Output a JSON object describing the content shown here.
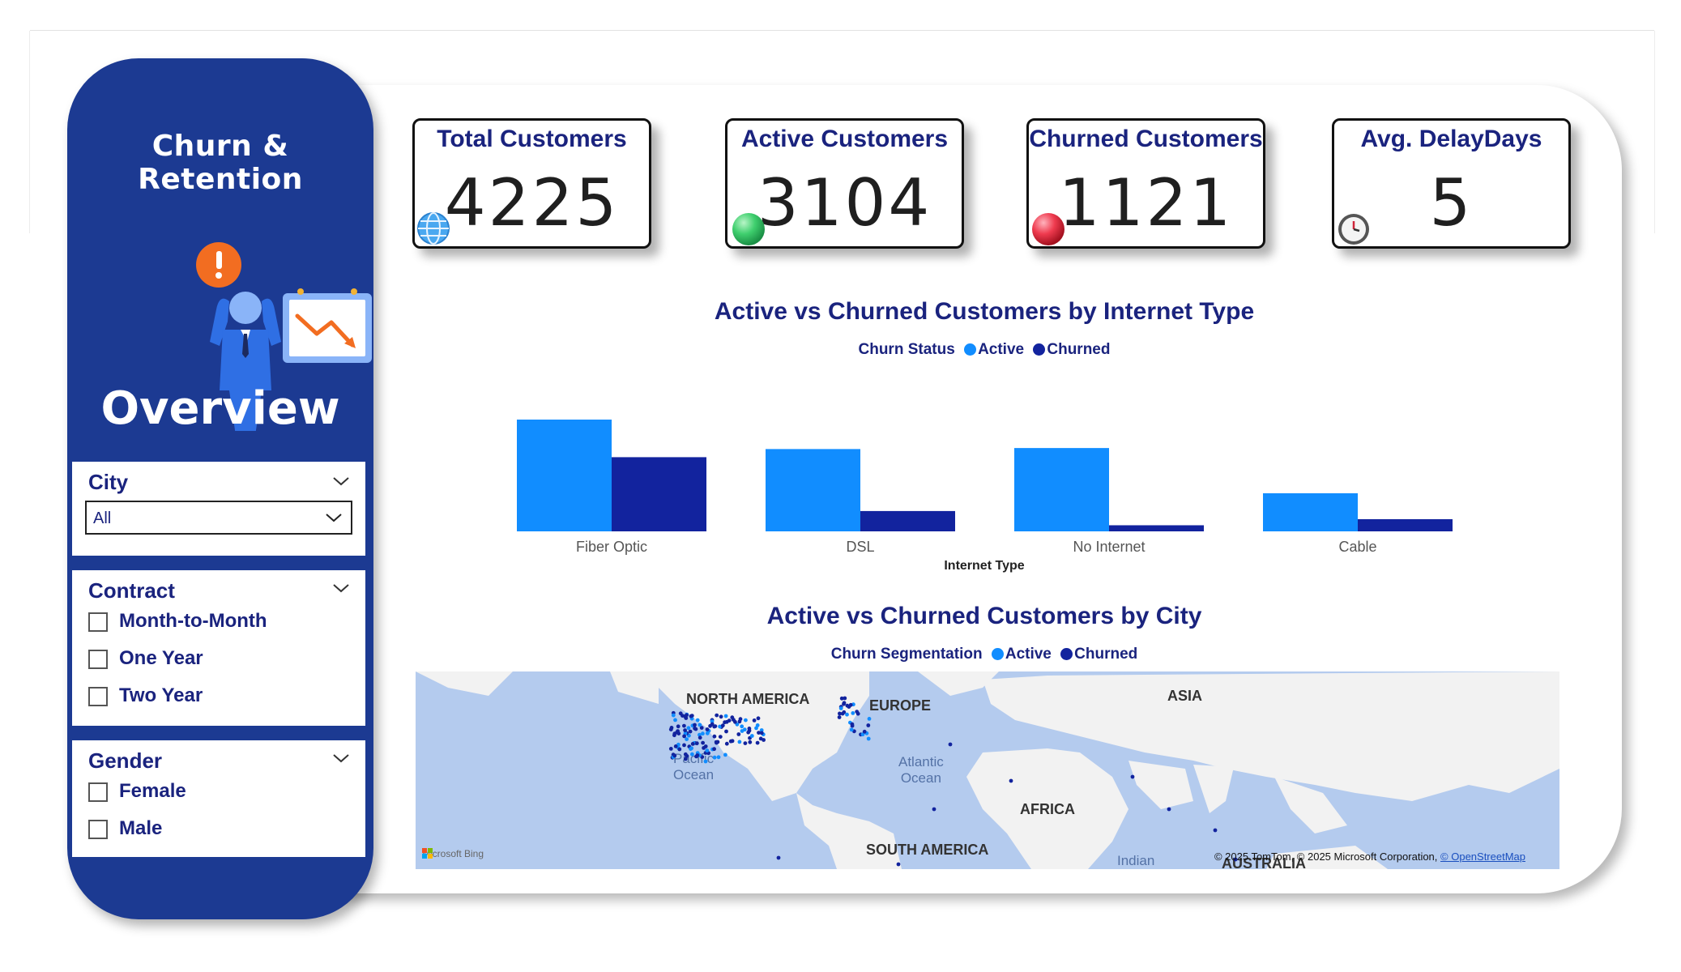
{
  "sidebar": {
    "title": "Churn & Retention",
    "overview_label": "Overview"
  },
  "slicers": {
    "city": {
      "title": "City",
      "selected": "All"
    },
    "contract": {
      "title": "Contract",
      "options": [
        "Month-to-Month",
        "One Year",
        "Two Year"
      ]
    },
    "gender": {
      "title": "Gender",
      "options": [
        "Female",
        "Male"
      ]
    }
  },
  "kpis": [
    {
      "title": "Total Customers",
      "value": "4225",
      "icon": "globe-icon"
    },
    {
      "title": "Active Customers",
      "value": "3104",
      "icon": "green-ball-icon"
    },
    {
      "title": "Churned Customers",
      "value": "1121",
      "icon": "red-ball-icon"
    },
    {
      "title": "Avg. DelayDays",
      "value": "5",
      "icon": "clock-icon"
    }
  ],
  "colors": {
    "active": "#118dff",
    "churned": "#12239e",
    "sidebar": "#1c3a92",
    "title_text": "#1a237e"
  },
  "bar_chart": {
    "title": "Active vs Churned Customers by Internet Type",
    "legend_title": "Churn Status",
    "legend_items": [
      "Active",
      "Churned"
    ],
    "axis_title": "Internet Type"
  },
  "chart_data": {
    "type": "bar",
    "title": "Active vs Churned Customers by Internet Type",
    "xlabel": "Internet Type",
    "ylabel": "",
    "categories": [
      "Fiber Optic",
      "DSL",
      "No Internet",
      "Cable"
    ],
    "series": [
      {
        "name": "Active",
        "values": [
          1100,
          810,
          820,
          375
        ]
      },
      {
        "name": "Churned",
        "values": [
          730,
          200,
          60,
          120
        ]
      }
    ],
    "ylim": [
      0,
      1100
    ],
    "grid": false,
    "legend_position": "top"
  },
  "map": {
    "title": "Active vs Churned Customers by City",
    "legend_title": "Churn Segmentation",
    "legend_items": [
      "Active",
      "Churned"
    ],
    "labels": {
      "north_america": "NORTH AMERICA",
      "europe": "EUROPE",
      "asia": "ASIA",
      "africa": "AFRICA",
      "south_america": "SOUTH AMERICA",
      "australia": "AUSTRALIA"
    },
    "oceans": {
      "pacific_line1": "Pacific",
      "pacific_line2": "Ocean",
      "atlantic_line1": "Atlantic",
      "atlantic_line2": "Ocean",
      "indian": "Indian"
    },
    "provider": "Microsoft Bing",
    "credit": "© 2025 TomTom, © 2025 Microsoft Corporation,",
    "credit_link": "© OpenStreetMap"
  }
}
